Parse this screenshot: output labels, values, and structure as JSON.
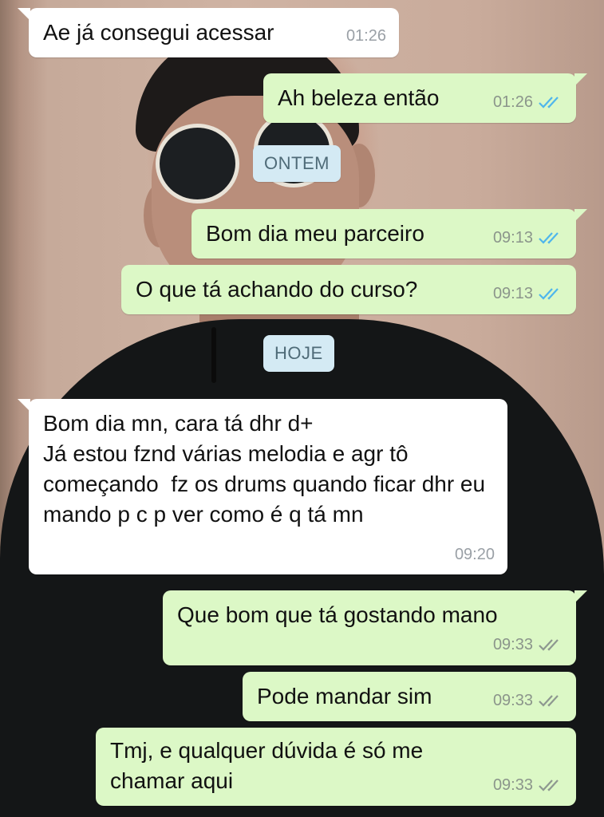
{
  "dates": {
    "yesterday": "ONTEM",
    "today": "HOJE"
  },
  "messages": [
    {
      "dir": "in",
      "text": "Ae já consegui acessar",
      "time": "01:26"
    },
    {
      "dir": "out",
      "text": "Ah beleza então",
      "time": "01:26",
      "status": "read"
    },
    {
      "dir": "out",
      "text": "Bom dia meu parceiro",
      "time": "09:13",
      "status": "read"
    },
    {
      "dir": "out",
      "text": "O que tá achando do curso?",
      "time": "09:13",
      "status": "read"
    },
    {
      "dir": "in",
      "text": "Bom dia mn, cara tá dhr d+\nJá estou fznd várias melodia e agr tô começando  fz os drums quando ficar dhr eu mando p c p ver como é q tá mn",
      "time": "09:20"
    },
    {
      "dir": "out",
      "text": "Que bom que tá gostando mano",
      "time": "09:33",
      "status": "delivered"
    },
    {
      "dir": "out",
      "text": "Pode mandar sim",
      "time": "09:33",
      "status": "delivered"
    },
    {
      "dir": "out",
      "text": "Tmj, e qualquer dúvida é só me chamar aqui",
      "time": "09:33",
      "status": "delivered"
    }
  ],
  "colors": {
    "outgoing_bubble": "#dcf8c6",
    "incoming_bubble": "#ffffff",
    "read_tick": "#4fb6ec",
    "delivered_tick": "#8e9890",
    "date_pill": "#d4eaf4"
  },
  "icons": {
    "read": "double-check-blue-icon",
    "delivered": "double-check-gray-icon"
  }
}
